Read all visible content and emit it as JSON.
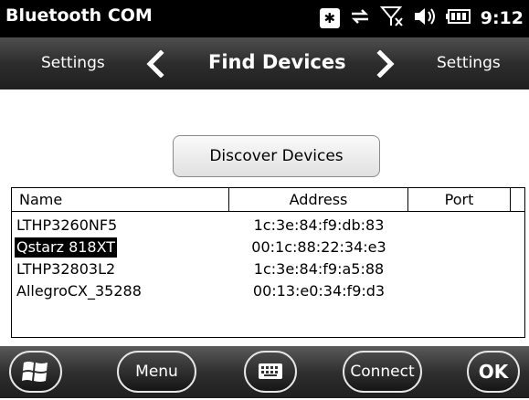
{
  "status_bar": {
    "app_title": "Bluetooth COM",
    "time": "9:12",
    "icons": [
      "bluetooth-icon",
      "data-connection-icon",
      "signal-no-service-icon",
      "volume-icon",
      "battery-icon"
    ]
  },
  "navigation": {
    "left_label": "Settings",
    "title": "Find Devices",
    "right_label": "Settings"
  },
  "discover_button_label": "Discover Devices",
  "device_list": {
    "columns": [
      "Name",
      "Address",
      "Port"
    ],
    "rows": [
      {
        "name": "LTHP3260NF5",
        "address": "1c:3e:84:f9:db:83",
        "port": ""
      },
      {
        "name": "Qstarz 818XT",
        "address": "00:1c:88:22:34:e3",
        "port": "",
        "selected": true
      },
      {
        "name": "LTHP32803L2",
        "address": "1c:3e:84:f9:a5:88",
        "port": ""
      },
      {
        "name": "AllegroCX_35288",
        "address": "00:13:e0:34:f9:d3",
        "port": ""
      }
    ]
  },
  "softkeys": {
    "menu": "Menu",
    "connect": "Connect",
    "ok": "OK"
  },
  "colors": {
    "title_bar": "#000000",
    "nav_bar": "#2d2d2d",
    "selection": "#000000"
  }
}
